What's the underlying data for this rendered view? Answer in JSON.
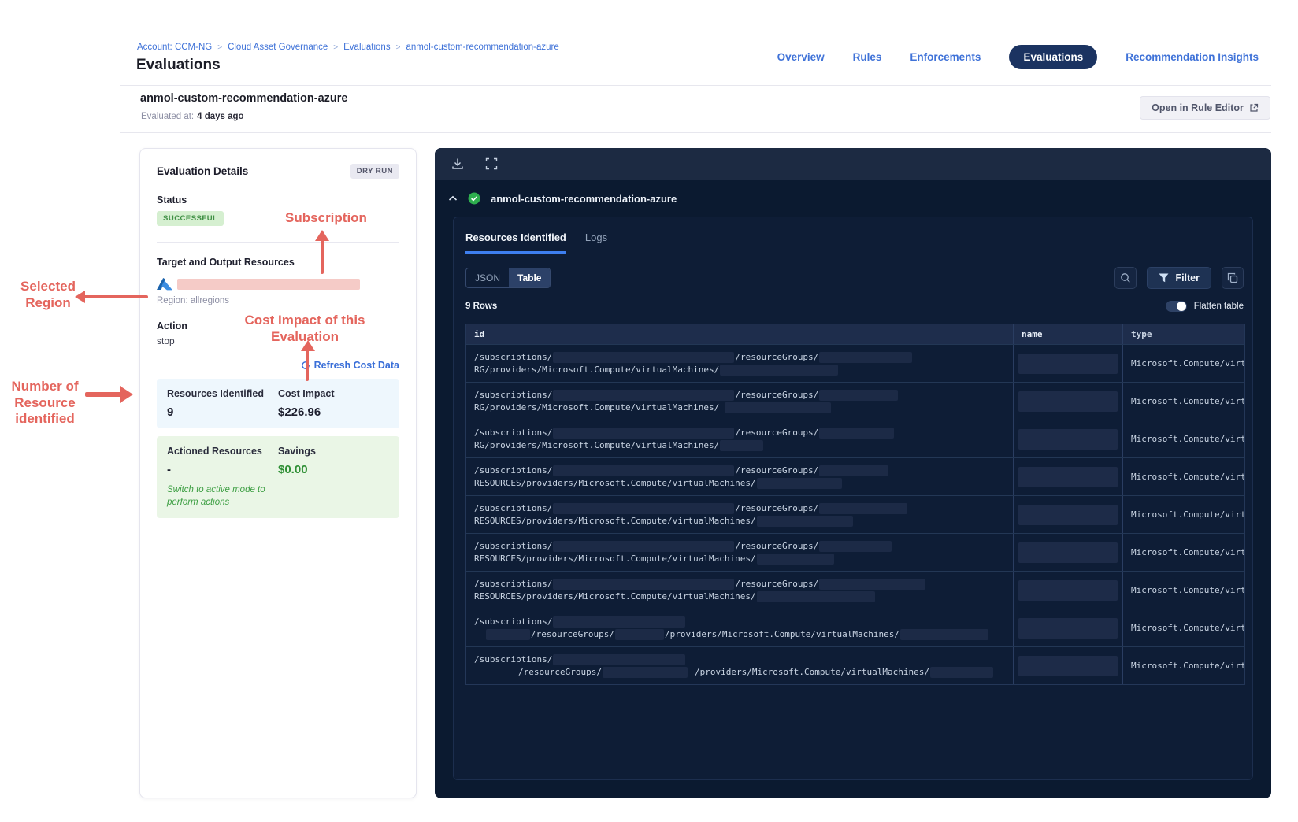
{
  "breadcrumb": [
    "Account: CCM-NG",
    "Cloud Asset Governance",
    "Evaluations",
    "anmol-custom-recommendation-azure"
  ],
  "page_title": "Evaluations",
  "nav_tabs": [
    {
      "label": "Overview",
      "active": false
    },
    {
      "label": "Rules",
      "active": false
    },
    {
      "label": "Enforcements",
      "active": false
    },
    {
      "label": "Evaluations",
      "active": true
    },
    {
      "label": "Recommendation Insights",
      "active": false
    }
  ],
  "subheader": {
    "name": "anmol-custom-recommendation-azure",
    "evaluated_label": "Evaluated at:",
    "evaluated_value": "4 days ago",
    "open_rule_editor_label": "Open in Rule Editor"
  },
  "evaluation_card": {
    "title": "Evaluation Details",
    "dry_run_badge": "DRY RUN",
    "status_label": "Status",
    "status_value": "SUCCESSFUL",
    "target_label": "Target and Output Resources",
    "region_text": "Region: allregions",
    "action_label": "Action",
    "action_value": "stop",
    "refresh_link": "Refresh Cost Data",
    "resources_identified_label": "Resources Identified",
    "resources_identified_value": "9",
    "cost_impact_label": "Cost Impact",
    "cost_impact_value": "$226.96",
    "actioned_label": "Actioned Resources",
    "actioned_value": "-",
    "savings_label": "Savings",
    "savings_value": "$0.00",
    "active_note_line1": "Switch to active mode to",
    "active_note_line2": "perform actions"
  },
  "annotations": {
    "accent_color": "#e4655d",
    "subscription": "Subscription",
    "selected_region_line1": "Selected",
    "selected_region_line2": "Region",
    "cost_line1": "Cost Impact of this",
    "cost_line2": "Evaluation",
    "count_line1": "Number of",
    "count_line2": "Resource",
    "count_line3": "identified"
  },
  "results_panel": {
    "title": "anmol-custom-recommendation-azure",
    "status_icon": "check-circle-green",
    "tabs": [
      {
        "label": "Resources Identified",
        "active": true
      },
      {
        "label": "Logs",
        "active": false
      }
    ],
    "view_toggle": [
      {
        "label": "JSON",
        "active": false
      },
      {
        "label": "Table",
        "active": true
      }
    ],
    "rows_count": "9 Rows",
    "flatten_label": "Flatten table",
    "filter_label": "Filter",
    "table": {
      "columns": [
        "id",
        "name",
        "type"
      ],
      "type_value": "Microsoft.Compute/virtu",
      "rows": [
        {
          "id_line1": [
            {
              "t": "/subscriptions/"
            },
            {
              "b": 230
            },
            {
              "t": "/resourceGroups/"
            },
            {
              "b": 118
            }
          ],
          "id_line2": [
            {
              "t": "RG/providers/Microsoft.Compute/virtualMachines/"
            },
            {
              "b": 150
            }
          ]
        },
        {
          "id_line1": [
            {
              "t": "/subscriptions/"
            },
            {
              "b": 230
            },
            {
              "t": "/resourceGroups/"
            },
            {
              "b": 100
            }
          ],
          "id_line2": [
            {
              "t": "RG/providers/Microsoft.Compute/virtualMachines/"
            },
            {
              "s": 6
            },
            {
              "b": 135
            }
          ]
        },
        {
          "id_line1": [
            {
              "t": "/subscriptions/"
            },
            {
              "b": 230
            },
            {
              "t": "/resourceGroups/"
            },
            {
              "b": 95
            }
          ],
          "id_line2": [
            {
              "t": "RG/providers/Microsoft.Compute/virtualMachines/"
            },
            {
              "b": 55
            }
          ]
        },
        {
          "id_line1": [
            {
              "t": "/subscriptions/"
            },
            {
              "b": 230
            },
            {
              "t": "/resourceGroups/"
            },
            {
              "b": 88
            }
          ],
          "id_line2": [
            {
              "t": "RESOURCES/providers/Microsoft.Compute/virtualMachines/"
            },
            {
              "b": 108
            }
          ]
        },
        {
          "id_line1": [
            {
              "t": "/subscriptions/"
            },
            {
              "b": 230
            },
            {
              "t": "/resourceGroups/"
            },
            {
              "b": 112
            }
          ],
          "id_line2": [
            {
              "t": "RESOURCES/providers/Microsoft.Compute/virtualMachines/"
            },
            {
              "b": 122
            }
          ]
        },
        {
          "id_line1": [
            {
              "t": "/subscriptions/"
            },
            {
              "b": 230
            },
            {
              "t": "/resourceGroups/"
            },
            {
              "b": 92
            }
          ],
          "id_line2": [
            {
              "t": "RESOURCES/providers/Microsoft.Compute/virtualMachines/"
            },
            {
              "b": 98
            }
          ]
        },
        {
          "id_line1": [
            {
              "t": "/subscriptions/"
            },
            {
              "b": 230
            },
            {
              "t": "/resourceGroups/"
            },
            {
              "b": 135
            }
          ],
          "id_line2": [
            {
              "t": "RESOURCES/providers/Microsoft.Compute/virtualMachines/"
            },
            {
              "b": 150
            }
          ]
        },
        {
          "id_line1": [
            {
              "t": "/subscriptions/"
            },
            {
              "b": 168
            }
          ],
          "id_line2": [
            {
              "s": 14
            },
            {
              "b": 56
            },
            {
              "t": "/resourceGroups/"
            },
            {
              "b": 62
            },
            {
              "t": "/providers/Microsoft.Compute/virtualMachines/"
            },
            {
              "b": 112
            }
          ]
        },
        {
          "id_line1": [
            {
              "t": "/subscriptions/"
            },
            {
              "b": 168
            }
          ],
          "id_line2": [
            {
              "s": 56
            },
            {
              "t": "/resourceGroups/"
            },
            {
              "b": 108
            },
            {
              "s": 8
            },
            {
              "t": "/providers/Microsoft.Compute/virtualMachines/"
            },
            {
              "b": 80
            }
          ]
        }
      ]
    }
  }
}
